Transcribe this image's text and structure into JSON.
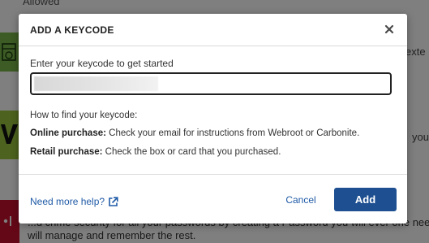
{
  "background": {
    "top_text": "Allowed",
    "right_text_1": "exte",
    "right_text_2": "your A",
    "bottom_text_1": "...d crime security for all your passwords by creating a Password you will ever one needed pass",
    "bottom_text_2": "will manage and remember the rest."
  },
  "modal": {
    "title": "ADD A KEYCODE",
    "close_glyph": "×",
    "input": {
      "label": "Enter your keycode to get started",
      "value": "",
      "placeholder": ""
    },
    "help": {
      "heading": "How to find your keycode:",
      "online_label": "Online purchase:",
      "online_text": " Check your email for instructions from Webroot or Carbonite.",
      "retail_label": "Retail purchase:",
      "retail_text": " Check the box or card that you purchased."
    },
    "footer": {
      "need_help_label": "Need more help?",
      "cancel_label": "Cancel",
      "add_label": "Add"
    }
  },
  "colors": {
    "primary_button": "#1d4f91",
    "link": "#1f5aa6",
    "overlay": "rgba(0,0,0,0.5)"
  },
  "icons": {
    "close": "close-icon",
    "need_help": "external-link-icon"
  }
}
